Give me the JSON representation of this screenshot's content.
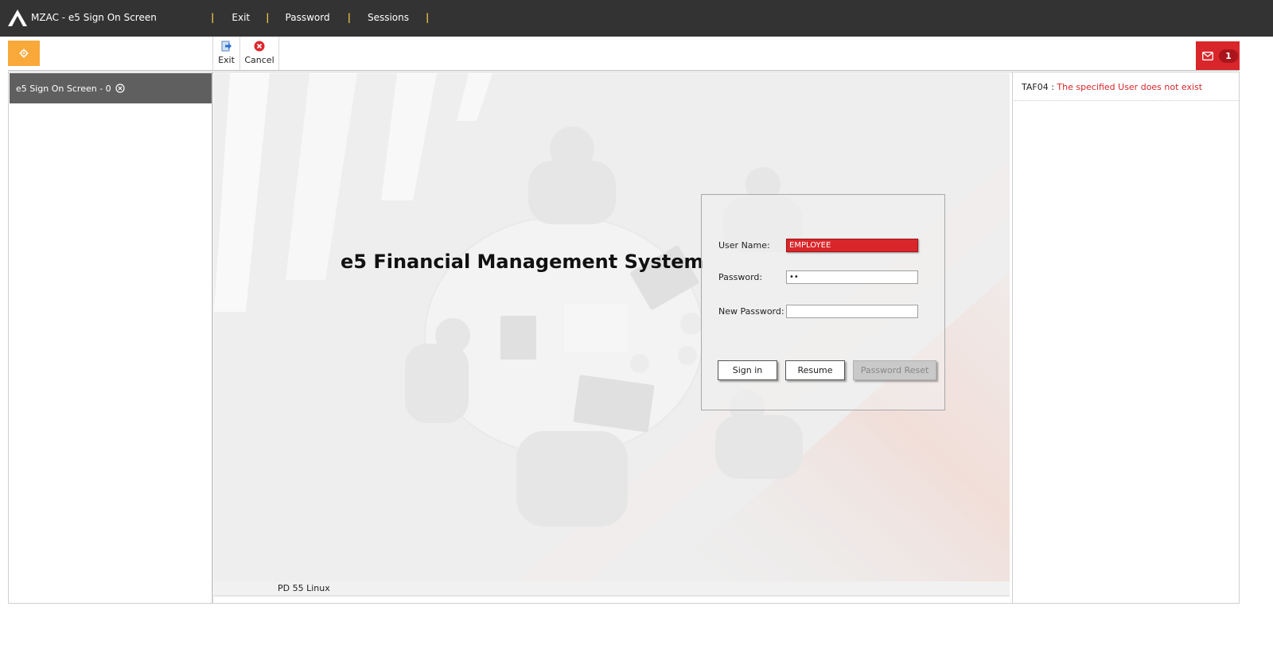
{
  "app": {
    "title": "MZAC - e5 Sign On Screen",
    "brand_color": "#333333",
    "accent_color": "#f8a93a",
    "error_color": "#d9262a"
  },
  "topnav": {
    "separator": "|",
    "items": [
      {
        "label": "Exit"
      },
      {
        "label": "Password"
      },
      {
        "label": "Sessions"
      }
    ]
  },
  "toolbar": {
    "settings_icon": "gear-icon",
    "exit_label": "Exit",
    "cancel_label": "Cancel",
    "messages_icon": "envelope-icon",
    "messages_count": "1"
  },
  "sidebar": {
    "session_tab": "e5 Sign On Screen - 0"
  },
  "main": {
    "system_title": "e5 Financial Management System",
    "login": {
      "username_label": "User Name:",
      "username_value": "EMPLOYEE",
      "password_label": "Password:",
      "password_value": "••",
      "new_password_label": "New Password:",
      "new_password_value": "",
      "signin_label": "Sign in",
      "resume_label": "Resume",
      "reset_label": "Password Reset"
    },
    "status": "PD 55 Linux"
  },
  "messages": {
    "items": [
      {
        "code": "TAF04",
        "separator": " : ",
        "text": "The specified User does not exist"
      }
    ]
  }
}
